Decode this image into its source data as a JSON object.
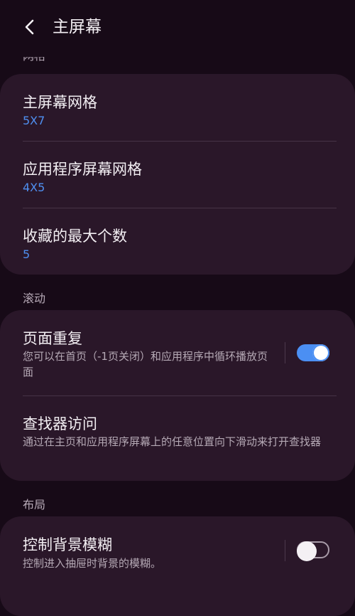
{
  "header": {
    "title": "主屏幕"
  },
  "sections": {
    "grid_label_partial": "网格",
    "scroll_label": "滚动",
    "layout_label": "布局"
  },
  "grid": {
    "home_grid": {
      "title": "主屏幕网格",
      "value": "5X7"
    },
    "apps_grid": {
      "title": "应用程序屏幕网格",
      "value": "4X5"
    },
    "favorites": {
      "title": "收藏的最大个数",
      "value": "5"
    }
  },
  "scroll": {
    "page_loop": {
      "title": "页面重复",
      "desc": "您可以在首页（-1页关闭）和应用程序中循环播放页面",
      "enabled": true
    },
    "finder": {
      "title": "查找器访问",
      "desc": "通过在主页和应用程序屏幕上的任意位置向下滑动来打开查找器"
    }
  },
  "layout": {
    "blur": {
      "title": "控制背景模糊",
      "desc": "控制进入抽屉时背景的模糊。",
      "enabled": false
    }
  },
  "colors": {
    "accent": "#4b8ff3",
    "card": "#2a1729",
    "background": "#170a17"
  },
  "icons": {
    "back": "chevron-left-icon"
  }
}
